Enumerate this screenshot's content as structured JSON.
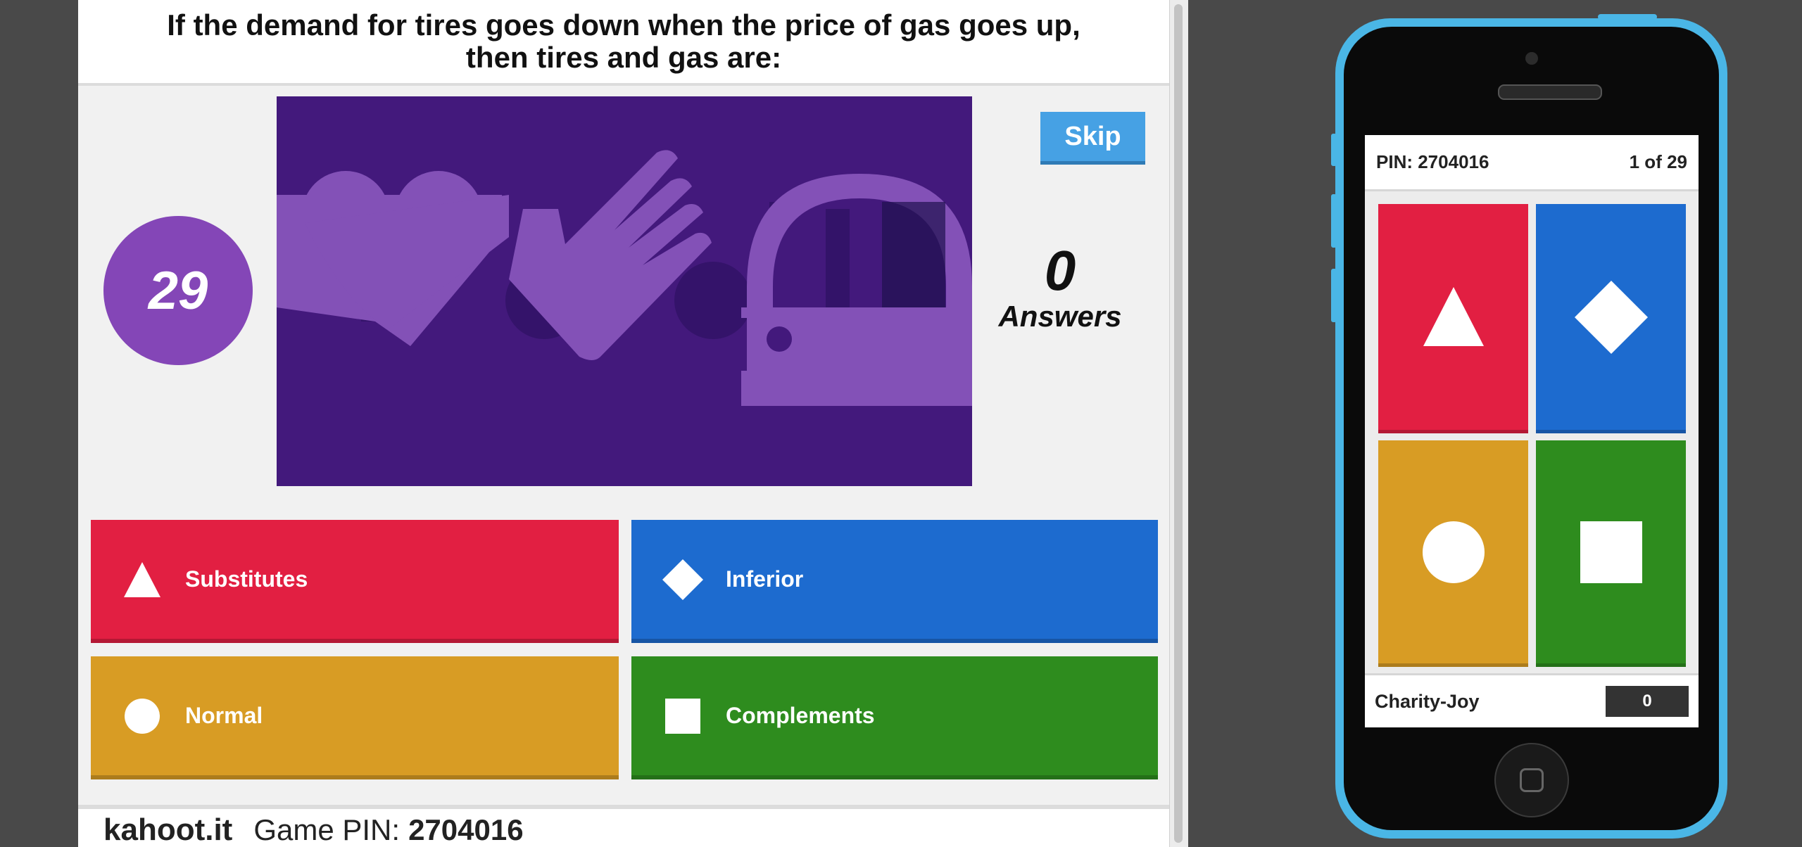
{
  "question": {
    "text": "If the demand for tires goes down when the price of gas goes up, then tires and gas are:"
  },
  "timer": {
    "value": "29"
  },
  "skip_button": {
    "label": "Skip"
  },
  "answers_count": {
    "number": "0",
    "label": "Answers"
  },
  "answers": [
    {
      "label": "Substitutes",
      "shape": "triangle-icon",
      "color": "#e21f42"
    },
    {
      "label": "Inferior",
      "shape": "diamond-icon",
      "color": "#1d6bcf"
    },
    {
      "label": "Normal",
      "shape": "circle-icon",
      "color": "#d89c24"
    },
    {
      "label": "Complements",
      "shape": "square-icon",
      "color": "#2e8c1e"
    }
  ],
  "footer": {
    "brand": "kahoot.it",
    "pin_label": "Game PIN:",
    "pin": "2704016"
  },
  "phone": {
    "pin": "PIN: 2704016",
    "progress": "1 of 29",
    "player_name": "Charity-Joy",
    "score": "0"
  },
  "colors": {
    "accent_purple": "#8446b7",
    "media_bg": "#43197c",
    "phone_case": "#4ab6e6"
  }
}
